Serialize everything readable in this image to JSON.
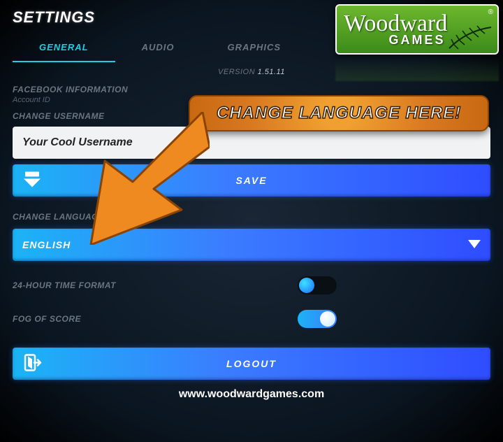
{
  "title": "SETTINGS",
  "tabs": {
    "general": "GENERAL",
    "audio": "AUDIO",
    "graphics": "GRAPHICS"
  },
  "version": {
    "label": "VERSION",
    "value": "1.51.11"
  },
  "facebook": {
    "heading": "FACEBOOK INFORMATION",
    "account_label": "Account ID"
  },
  "username": {
    "heading": "CHANGE USERNAME",
    "value": "Your Cool Username"
  },
  "save_label": "SAVE",
  "language": {
    "heading": "CHANGE LANGUAGE",
    "selected": "ENGLISH"
  },
  "time_format": {
    "label": "24-HOUR TIME FORMAT",
    "on": false
  },
  "fog_of_score": {
    "label": "FOG OF SCORE",
    "on": true
  },
  "logout_label": "LOGOUT",
  "footer_url": "www.woodwardgames.com",
  "badge": {
    "brand_top": "Woodward",
    "brand_bottom": "GAMES",
    "reg": "®"
  },
  "callout_text": "CHANGE LANGUAGE HERE!"
}
